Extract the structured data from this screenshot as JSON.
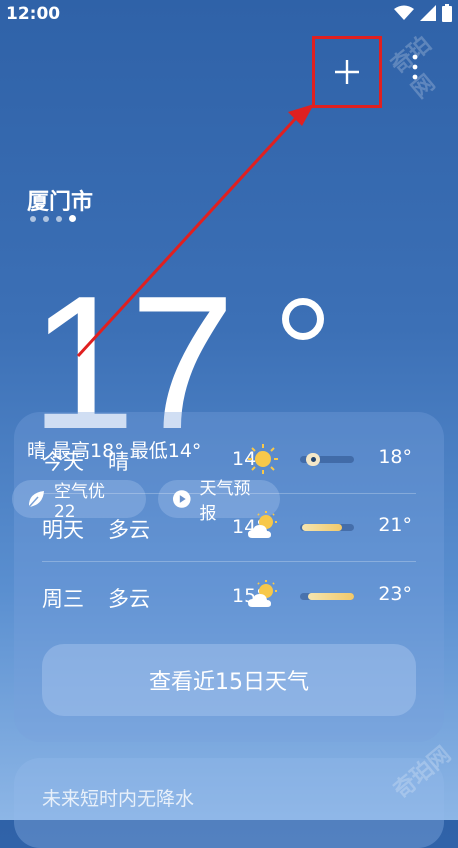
{
  "status": {
    "time": "12:00"
  },
  "header": {
    "add_icon": "plus-icon",
    "more_icon": "more-vertical-icon"
  },
  "location": {
    "city": "厦门市",
    "page_count": 4,
    "active_page": 4
  },
  "current": {
    "temperature": "17",
    "summary": "晴  最高18°  最低14°"
  },
  "chips": {
    "air_quality": "空气优 22",
    "forecast": "天气预报"
  },
  "forecast": [
    {
      "day": "今天",
      "condition": "晴",
      "low": "14°",
      "high": "18°",
      "icon": "sun-icon"
    },
    {
      "day": "明天",
      "condition": "多云",
      "low": "14°",
      "high": "21°",
      "icon": "partly-cloudy-icon"
    },
    {
      "day": "周三",
      "condition": "多云",
      "low": "15°",
      "high": "23°",
      "icon": "partly-cloudy-icon"
    }
  ],
  "buttons": {
    "fifteen_day": "查看近15日天气"
  },
  "rain": {
    "text": "未来短时内无降水"
  },
  "watermark": "奇珀网",
  "annotation": {
    "color": "#e02020"
  }
}
